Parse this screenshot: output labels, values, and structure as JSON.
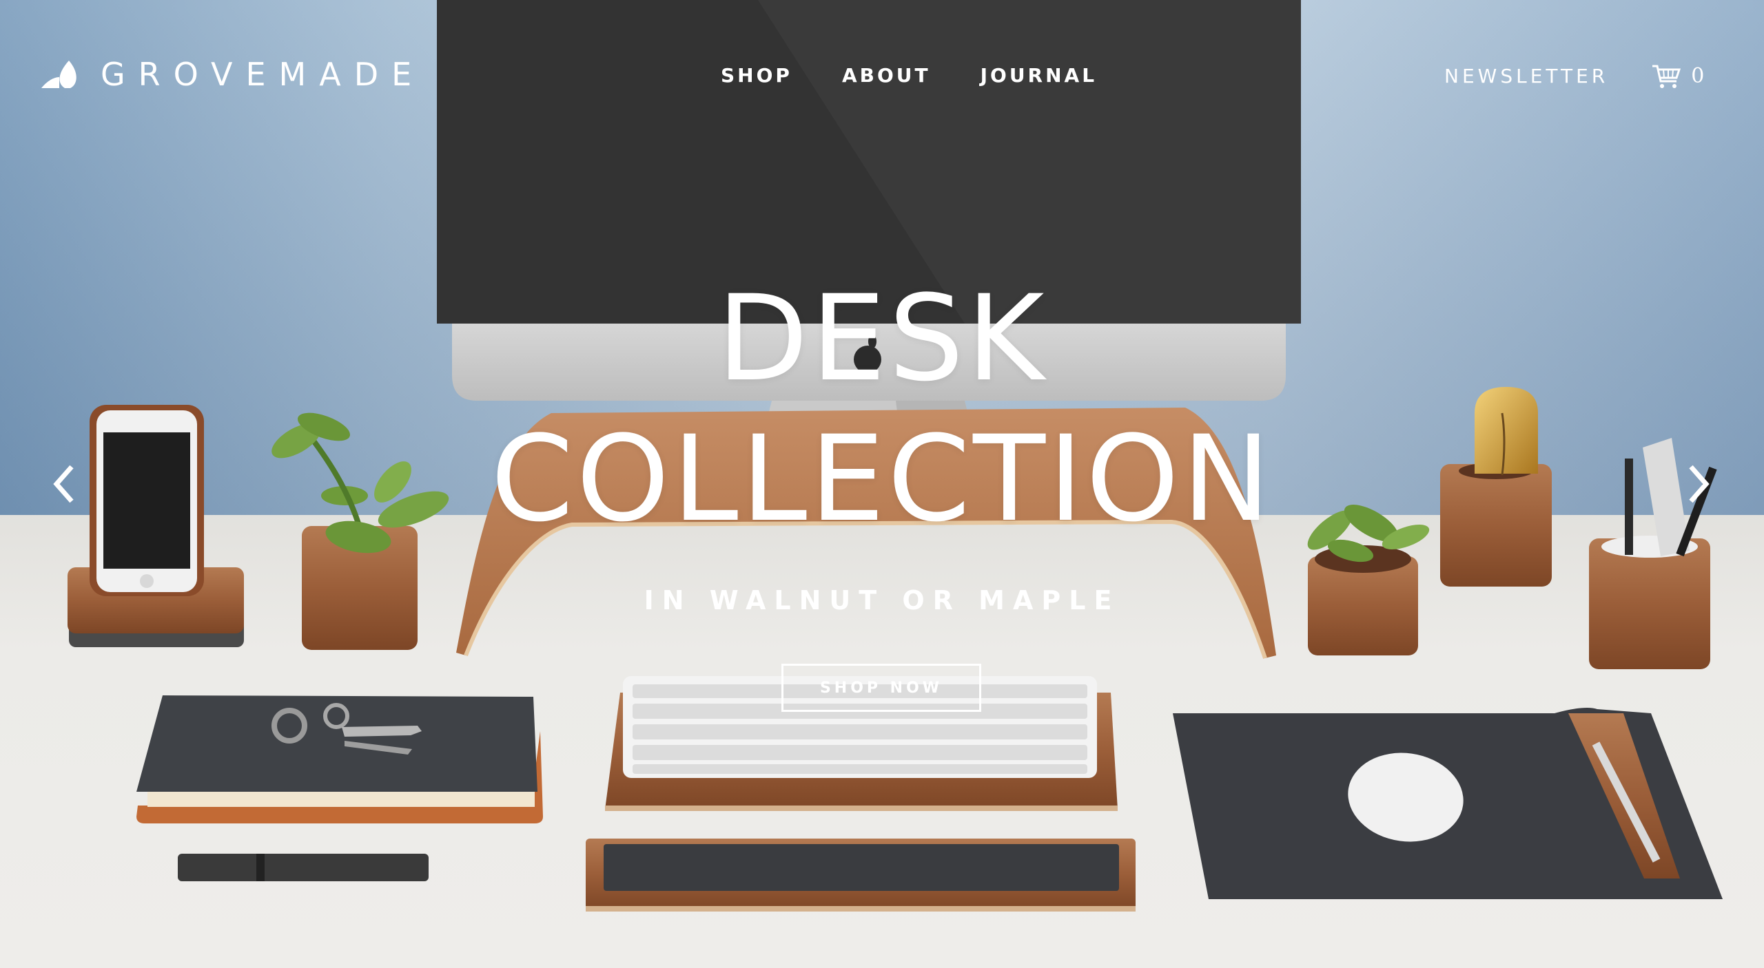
{
  "brand": {
    "name": "GROVEMADE",
    "logo_icon": "leaf-mark-icon"
  },
  "nav": {
    "items": [
      {
        "label": "SHOP"
      },
      {
        "label": "ABOUT"
      },
      {
        "label": "JOURNAL"
      }
    ],
    "newsletter_label": "NEWSLETTER",
    "cart_icon": "cart-icon",
    "cart_count": "0"
  },
  "hero": {
    "title_line1": "DESK",
    "title_line2": "COLLECTION",
    "subtitle": "IN WALNUT OR MAPLE",
    "cta_label": "SHOP NOW",
    "prev_icon": "chevron-left-icon",
    "next_icon": "chevron-right-icon"
  },
  "colors": {
    "wall_blue": "#a4bdd3",
    "desk_white": "#ecebe8",
    "walnut": "#9a5a36",
    "text": "#ffffff"
  }
}
